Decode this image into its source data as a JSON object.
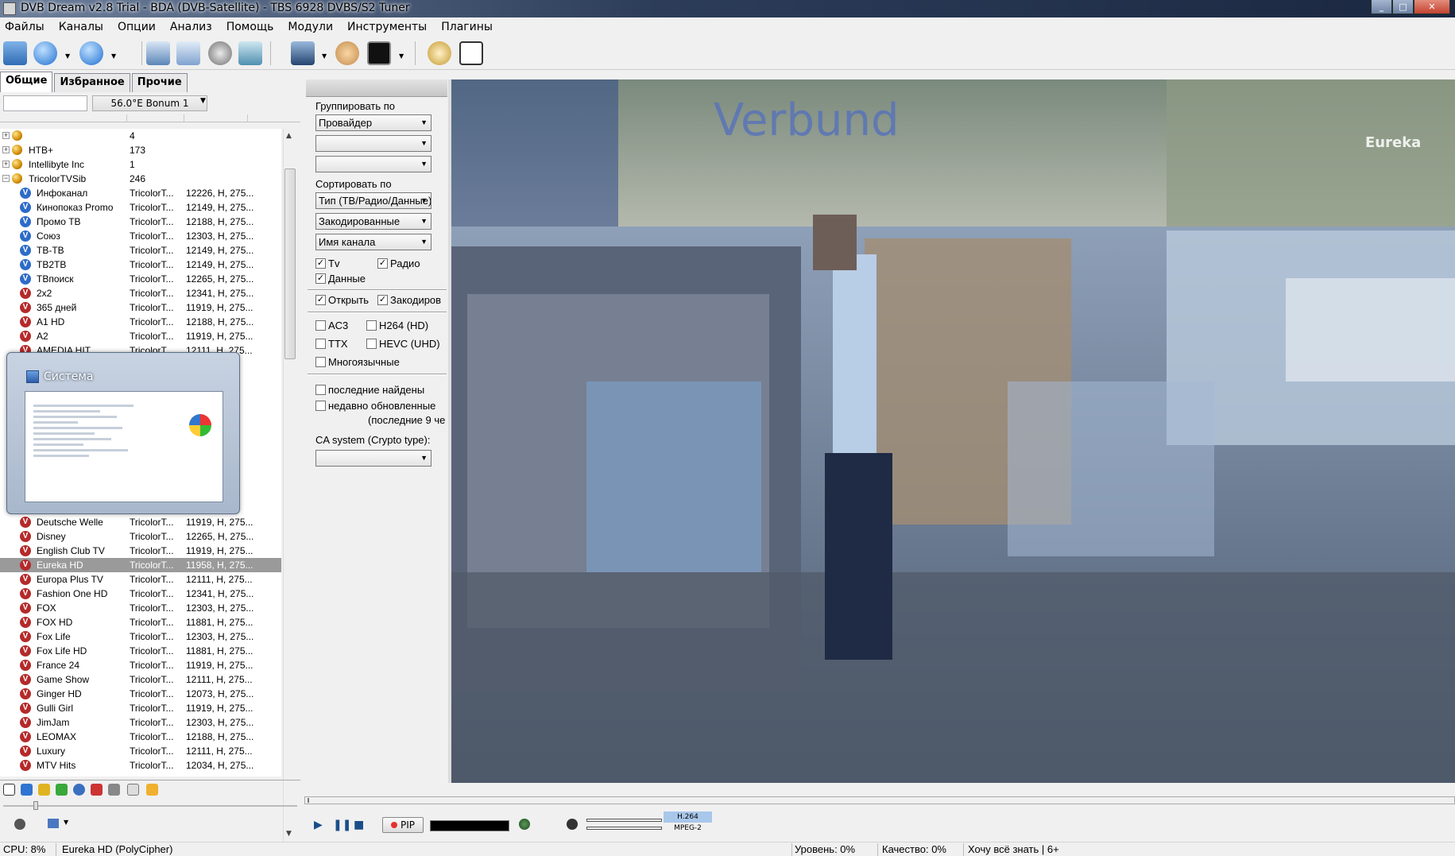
{
  "window": {
    "title": "DVB Dream v2.8 Trial - BDA (DVB-Satellite)  -  TBS 6928 DVBS/S2 Tuner"
  },
  "menu": [
    "Файлы",
    "Каналы",
    "Опции",
    "Анализ",
    "Помощь",
    "Модули",
    "Инструменты",
    "Плагины"
  ],
  "tabs": [
    "Общие",
    "Избранное",
    "Прочие"
  ],
  "satellite": "56.0°E Bonum 1",
  "channels": [
    {
      "type": "group",
      "name": "",
      "count": "4"
    },
    {
      "type": "group",
      "name": "НТВ+",
      "count": "173"
    },
    {
      "type": "group",
      "name": "Intellibyte Inc",
      "count": "1"
    },
    {
      "type": "group",
      "name": "TricolorTVSib",
      "count": "246",
      "expanded": true
    },
    {
      "type": "ch",
      "icon": "tv",
      "name": "Инфоканал",
      "prov": "TricolorT...",
      "freq": "12226, H, 275..."
    },
    {
      "type": "ch",
      "icon": "tv",
      "name": "Кинопоказ Promo",
      "prov": "TricolorT...",
      "freq": "12149, H, 275..."
    },
    {
      "type": "ch",
      "icon": "tv",
      "name": "Промо ТВ",
      "prov": "TricolorT...",
      "freq": "12188, H, 275..."
    },
    {
      "type": "ch",
      "icon": "tv",
      "name": "Союз",
      "prov": "TricolorT...",
      "freq": "12303, H, 275..."
    },
    {
      "type": "ch",
      "icon": "tv",
      "name": "ТВ-ТВ",
      "prov": "TricolorT...",
      "freq": "12149, H, 275..."
    },
    {
      "type": "ch",
      "icon": "tv",
      "name": "ТВ2ТВ",
      "prov": "TricolorT...",
      "freq": "12149, H, 275..."
    },
    {
      "type": "ch",
      "icon": "tv",
      "name": "ТВпоиск",
      "prov": "TricolorT...",
      "freq": "12265, H, 275..."
    },
    {
      "type": "ch",
      "icon": "enc",
      "name": "2x2",
      "prov": "TricolorT...",
      "freq": "12341, H, 275..."
    },
    {
      "type": "ch",
      "icon": "enc",
      "name": "365 дней",
      "prov": "TricolorT...",
      "freq": "11919, H, 275..."
    },
    {
      "type": "ch",
      "icon": "enc",
      "name": "A1 HD",
      "prov": "TricolorT...",
      "freq": "12188, H, 275..."
    },
    {
      "type": "ch",
      "icon": "enc",
      "name": "A2",
      "prov": "TricolorT...",
      "freq": "11919, H, 275..."
    },
    {
      "type": "ch",
      "icon": "enc",
      "name": "AMEDIA HIT",
      "prov": "TricolorT...",
      "freq": "12111, H, 275..."
    },
    {
      "type": "hidden"
    },
    {
      "type": "hidden"
    },
    {
      "type": "hidden"
    },
    {
      "type": "hidden"
    },
    {
      "type": "hidden"
    },
    {
      "type": "hidden"
    },
    {
      "type": "hidden"
    },
    {
      "type": "hidden"
    },
    {
      "type": "hidden"
    },
    {
      "type": "hidden"
    },
    {
      "type": "hidden"
    },
    {
      "type": "ch",
      "icon": "enc",
      "name": "Deutsche Welle",
      "prov": "TricolorT...",
      "freq": "11919, H, 275..."
    },
    {
      "type": "ch",
      "icon": "enc",
      "name": "Disney",
      "prov": "TricolorT...",
      "freq": "12265, H, 275..."
    },
    {
      "type": "ch",
      "icon": "enc",
      "name": "English Club TV",
      "prov": "TricolorT...",
      "freq": "11919, H, 275..."
    },
    {
      "type": "ch",
      "icon": "enc",
      "name": "Eureka HD",
      "prov": "TricolorT...",
      "freq": "11958, H, 275...",
      "selected": true
    },
    {
      "type": "ch",
      "icon": "enc",
      "name": "Europa Plus TV",
      "prov": "TricolorT...",
      "freq": "12111, H, 275..."
    },
    {
      "type": "ch",
      "icon": "enc",
      "name": "Fashion One HD",
      "prov": "TricolorT...",
      "freq": "12341, H, 275..."
    },
    {
      "type": "ch",
      "icon": "enc",
      "name": "FOX",
      "prov": "TricolorT...",
      "freq": "12303, H, 275..."
    },
    {
      "type": "ch",
      "icon": "enc",
      "name": "FOX HD",
      "prov": "TricolorT...",
      "freq": "11881, H, 275..."
    },
    {
      "type": "ch",
      "icon": "enc",
      "name": "Fox Life",
      "prov": "TricolorT...",
      "freq": "12303, H, 275..."
    },
    {
      "type": "ch",
      "icon": "enc",
      "name": "Fox Life HD",
      "prov": "TricolorT...",
      "freq": "11881, H, 275..."
    },
    {
      "type": "ch",
      "icon": "enc",
      "name": "France 24",
      "prov": "TricolorT...",
      "freq": "11919, H, 275..."
    },
    {
      "type": "ch",
      "icon": "enc",
      "name": "Game Show",
      "prov": "TricolorT...",
      "freq": "12111, H, 275..."
    },
    {
      "type": "ch",
      "icon": "enc",
      "name": "Ginger HD",
      "prov": "TricolorT...",
      "freq": "12073, H, 275..."
    },
    {
      "type": "ch",
      "icon": "enc",
      "name": "Gulli Girl",
      "prov": "TricolorT...",
      "freq": "11919, H, 275..."
    },
    {
      "type": "ch",
      "icon": "enc",
      "name": "JimJam",
      "prov": "TricolorT...",
      "freq": "12303, H, 275..."
    },
    {
      "type": "ch",
      "icon": "enc",
      "name": "LEOMAX",
      "prov": "TricolorT...",
      "freq": "12188, H, 275..."
    },
    {
      "type": "ch",
      "icon": "enc",
      "name": "Luxury",
      "prov": "TricolorT...",
      "freq": "12111, H, 275..."
    },
    {
      "type": "ch",
      "icon": "enc",
      "name": "MTV Hits",
      "prov": "TricolorT...",
      "freq": "12034, H, 275..."
    }
  ],
  "thumbnail": {
    "title": "Система"
  },
  "filters": {
    "group_label": "Группировать по",
    "group_by": "Провайдер",
    "sort_label": "Сортировать по",
    "sort1": "Тип (ТВ/Радио/Данные)",
    "sort2": "Закодированные",
    "sort3": "Имя канала",
    "tv": "Tv",
    "radio": "Радио",
    "data": "Данные",
    "open": "Открыть",
    "encrypted": "Закодиров",
    "ac3": "AC3",
    "h264": "H264 (HD)",
    "ttx": "TTX",
    "hevc": "HEVC (UHD)",
    "multilang": "Многоязычные",
    "last_found": "последние найдены",
    "recently_updated": "недавно обновленные",
    "recent_note": "(последние 9 че",
    "ca_label": "CA system (Crypto type):"
  },
  "video": {
    "overlay_text": "Verbund",
    "logo": "Eureka"
  },
  "player": {
    "pip": "PIP",
    "codec1": "H.264",
    "codec2": "MPEG-2"
  },
  "status": {
    "cpu": "CPU: 8%",
    "channel": "Eureka HD (PolyCipher)",
    "level": "Уровень: 0%",
    "quality": "Качество: 0%",
    "extra": "Хочу всё знать | 6+"
  }
}
